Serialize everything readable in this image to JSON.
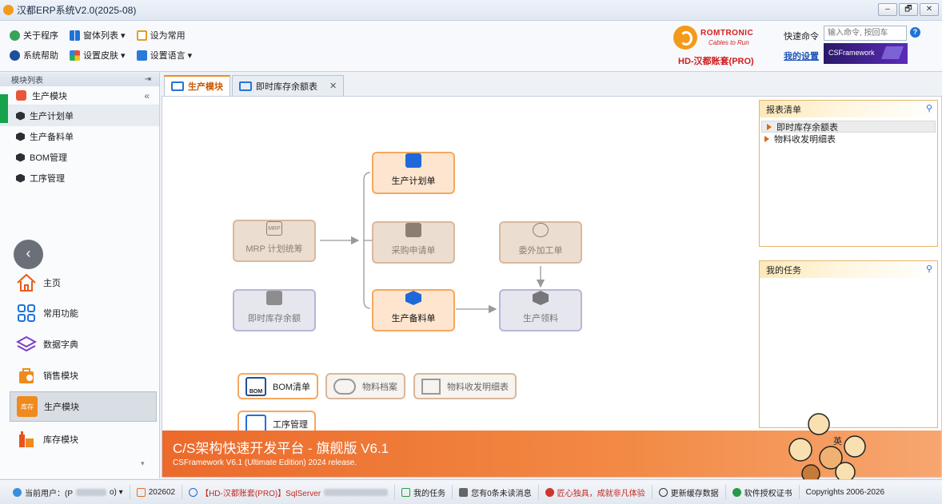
{
  "window": {
    "title": "汉都ERP系统V2.0(2025-08)",
    "controls": [
      "–",
      "🗗",
      "✕"
    ]
  },
  "toolbar": {
    "row1": [
      {
        "label": "关于程序",
        "icon": "info-globe-icon"
      },
      {
        "label": "窗体列表 ▾",
        "icon": "windows-icon"
      },
      {
        "label": "设为常用",
        "icon": "checklist-icon"
      }
    ],
    "row2": [
      {
        "label": "系统帮助",
        "icon": "help-icon"
      },
      {
        "label": "设置皮肤 ▾",
        "icon": "skin-grid-icon"
      },
      {
        "label": "设置语言 ▾",
        "icon": "language-icon"
      }
    ],
    "logo_brand": "ROMTRONIC",
    "logo_tagline": "Cables to Run",
    "logo_name": "HD-汉都账套(PRO)",
    "quick_command_label": "快速命令",
    "quick_command_placeholder": "输入命令, 按回车",
    "my_settings": "我的设置",
    "banner_text": "CSFramework"
  },
  "sidebar": {
    "header": "模块列表",
    "header_pin": "⇥",
    "module": "生产模块",
    "module_collapse": "«",
    "items": [
      "生产计划单",
      "生产备料单",
      "BOM管理",
      "工序管理"
    ],
    "nav": [
      {
        "label": "主页",
        "icon": "home-icon"
      },
      {
        "label": "常用功能",
        "icon": "apps-grid-icon"
      },
      {
        "label": "数据字典",
        "icon": "layers-icon"
      },
      {
        "label": "销售模块",
        "icon": "sales-bag-icon"
      },
      {
        "label": "生产模块",
        "icon": "production-icon"
      },
      {
        "label": "库存模块",
        "icon": "inventory-icon"
      }
    ],
    "back_glyph": "‹",
    "scroll_glyph": "▾",
    "production_badge": "库存"
  },
  "tabs": [
    {
      "label": "生产模块",
      "active": true
    },
    {
      "label": "即时库存余额表",
      "active": false,
      "close": "✕"
    }
  ],
  "flow": {
    "mrp": "MRP 计划统筹",
    "plan": "生产计划单",
    "purchase": "采购申请单",
    "prep": "生产备料单",
    "outsource": "委外加工单",
    "issue": "生产领料",
    "stock": "即时库存余额",
    "mrp_icon_text": "MRP",
    "bom_icon_text": "BOM"
  },
  "shortcuts": [
    {
      "label": "BOM清单",
      "icon": "bom-icon"
    },
    {
      "label": "物料档案",
      "icon": "material-icon"
    },
    {
      "label": "物料收发明细表",
      "icon": "material-flow-icon"
    },
    {
      "label": "工序管理",
      "icon": "process-icon"
    }
  ],
  "banner": {
    "title": "C/S架构快速开发平台 - 旗舰版 V6.1",
    "subtitle": "CSFramework V6.1 (Ultimate Edition) 2024 release."
  },
  "reports_panel": {
    "title": "报表清单",
    "items": [
      "即时库存余额表",
      "物料收发明细表"
    ]
  },
  "tasks_panel": {
    "title": "我的任务"
  },
  "statusbar": {
    "user_label": "当前用户：(P",
    "user_suffix": "o) ▾",
    "period": "202602",
    "db": "【HD-汉都账套(PRO)】SqlServer",
    "tasks": "我的任务",
    "messages": "您有0条未读消息",
    "slogan": "匠心独具，成就非凡体验",
    "refresh": "更新缓存数据",
    "license": "软件授权证书",
    "copyright": "Copyrights 2006-2026"
  },
  "mascot_text": "英",
  "colors": {
    "accent": "#f08a1c",
    "brand_red": "#d4201f",
    "link": "#1f55b8",
    "banner": "#ec6a2b"
  }
}
